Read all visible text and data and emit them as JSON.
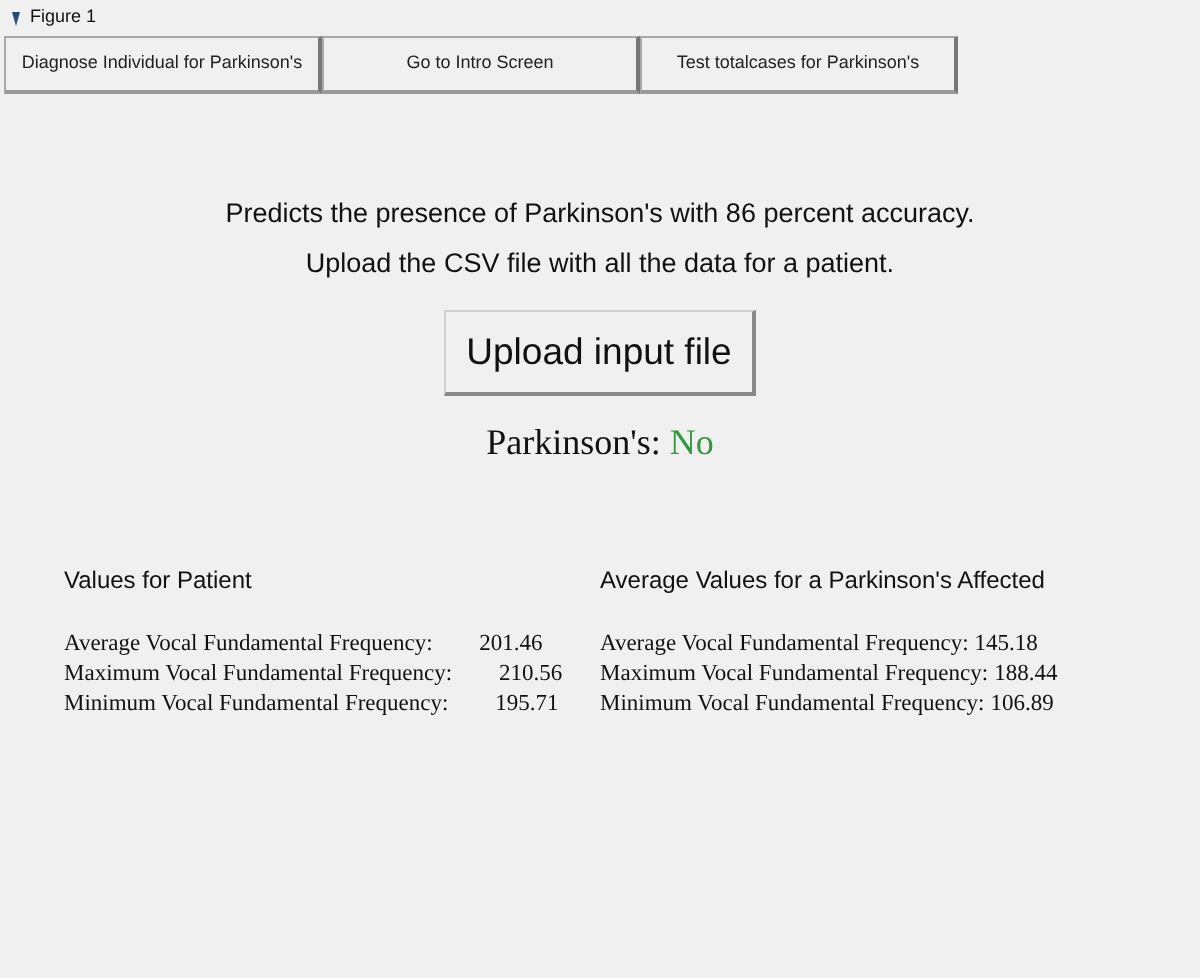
{
  "window": {
    "title": "Figure 1"
  },
  "tabs": [
    {
      "label": "Diagnose Individual for Parkinson's"
    },
    {
      "label": "Go to Intro Screen"
    },
    {
      "label": "Test totalcases for Parkinson's"
    }
  ],
  "intro": [
    "Predicts the presence of Parkinson's with 86 percent accuracy.",
    "Upload the CSV file with all the data for a patient."
  ],
  "upload_button": "Upload input file",
  "result": {
    "label": "Parkinson's:",
    "value": "No"
  },
  "panels": [
    {
      "title": "Values for Patient",
      "rows": [
        {
          "label": "Average Vocal Fundamental Frequency:",
          "value": "201.46"
        },
        {
          "label": "Maximum Vocal Fundamental Frequency:",
          "value": "210.56"
        },
        {
          "label": "Minimum Vocal Fundamental Frequency:",
          "value": "195.71"
        }
      ]
    },
    {
      "title": "Average Values for a Parkinson's Affected",
      "rows": [
        {
          "label": "Average Vocal Fundamental Frequency:",
          "value": "145.18"
        },
        {
          "label": "Maximum Vocal Fundamental Frequency:",
          "value": "188.44"
        },
        {
          "label": "Minimum Vocal Fundamental Frequency:",
          "value": "106.89"
        }
      ]
    }
  ]
}
